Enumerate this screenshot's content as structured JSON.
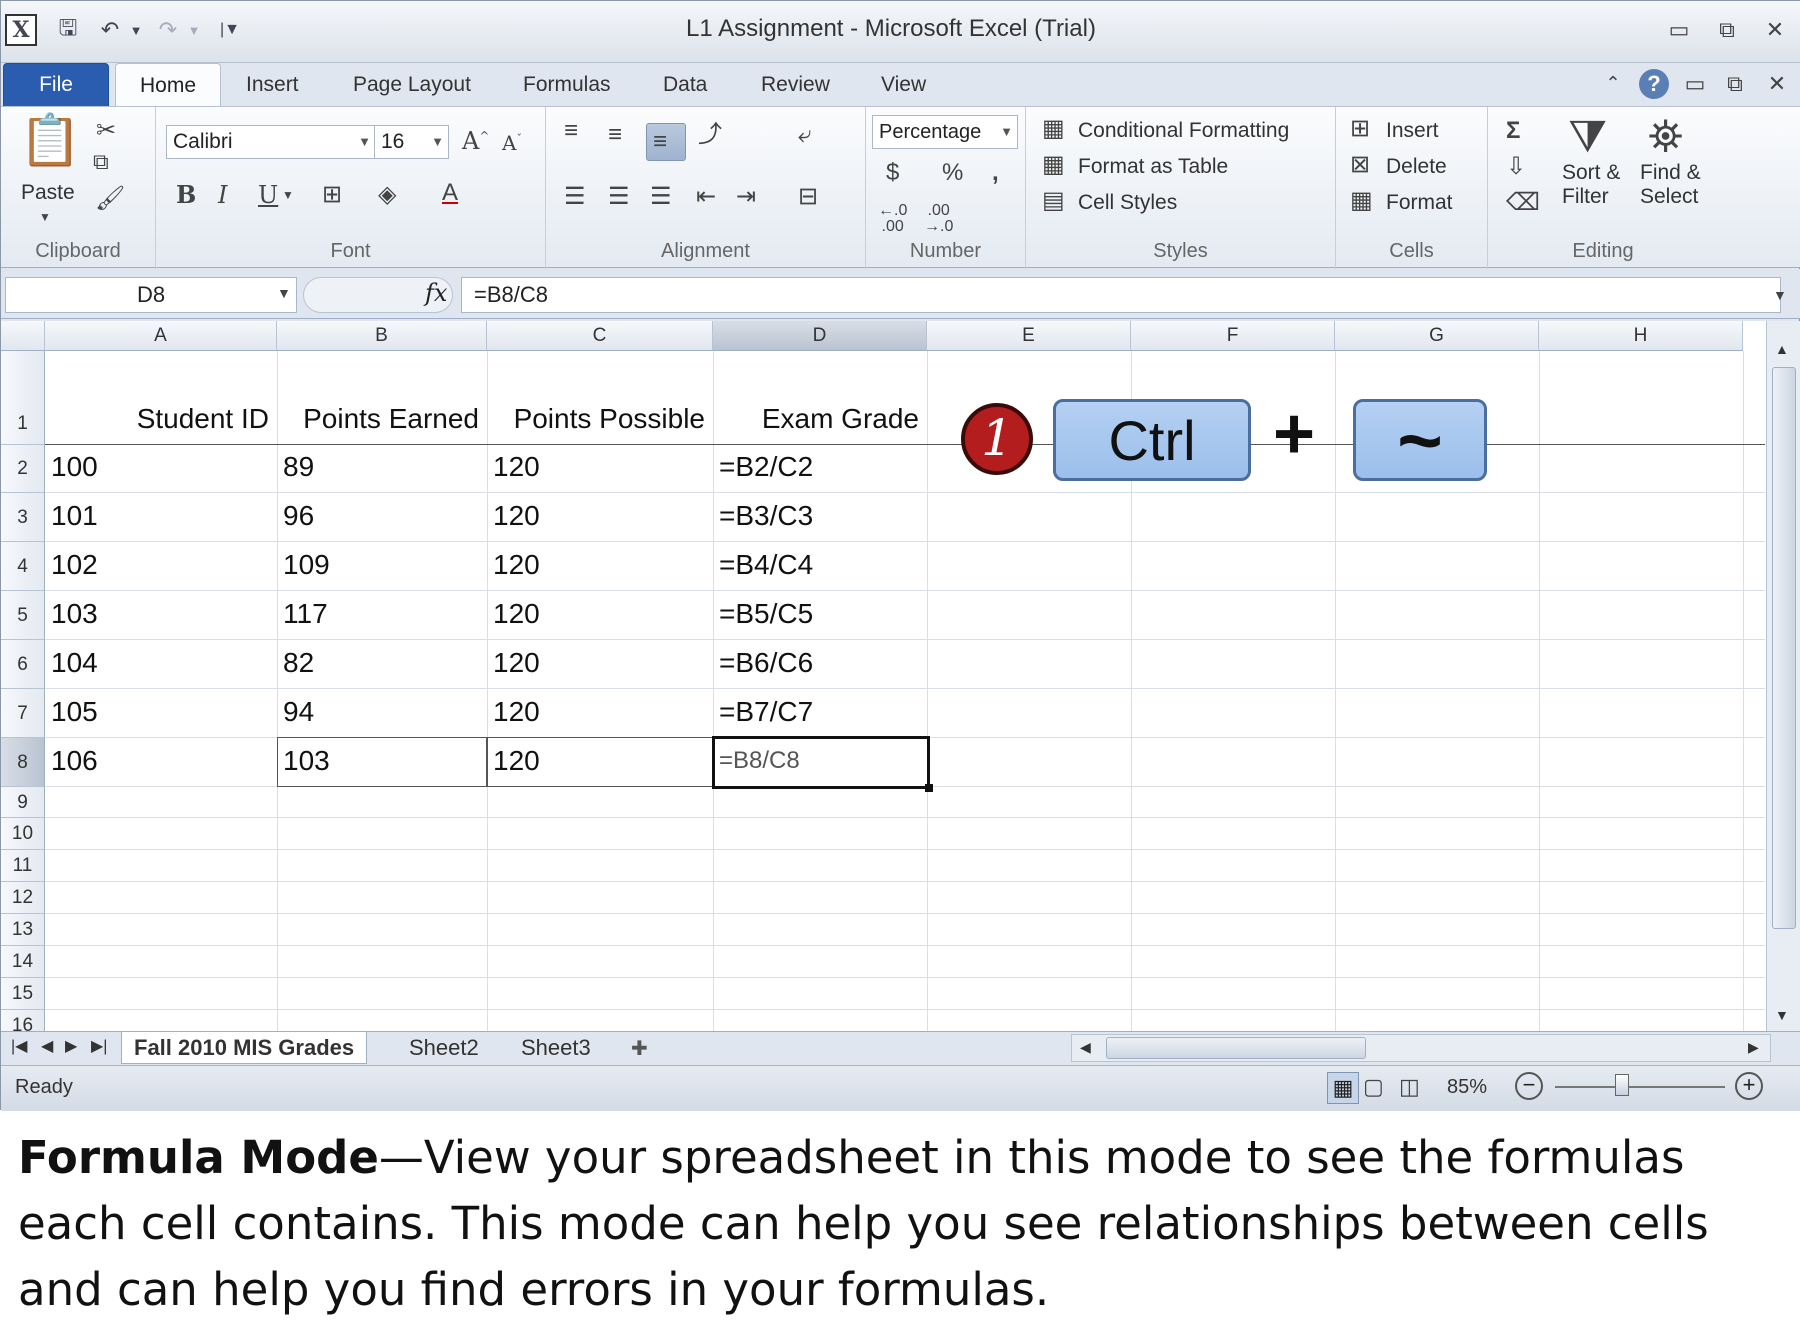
{
  "window": {
    "title": "L1 Assignment  -  Microsoft Excel (Trial)"
  },
  "tabs": [
    "File",
    "Home",
    "Insert",
    "Page Layout",
    "Formulas",
    "Data",
    "Review",
    "View"
  ],
  "ribbon": {
    "clipboard": {
      "label": "Clipboard",
      "paste": "Paste"
    },
    "font": {
      "label": "Font",
      "name": "Calibri",
      "size": "16",
      "bold": "B",
      "italic": "I",
      "underline": "U"
    },
    "alignment": {
      "label": "Alignment"
    },
    "number": {
      "label": "Number",
      "format": "Percentage",
      "currency": "$",
      "percent": "%",
      "comma": ","
    },
    "styles": {
      "label": "Styles",
      "conditional": "Conditional Formatting",
      "format_table": "Format as Table",
      "cell_styles": "Cell Styles"
    },
    "cells": {
      "label": "Cells",
      "insert": "Insert",
      "delete": "Delete",
      "format": "Format"
    },
    "editing": {
      "label": "Editing",
      "sum": "Σ",
      "sort1": "Sort &",
      "sort2": "Filter",
      "find1": "Find &",
      "find2": "Select"
    }
  },
  "formula_bar": {
    "name_box": "D8",
    "fx": "fx",
    "formula": "=B8/C8"
  },
  "columns": [
    "A",
    "B",
    "C",
    "D",
    "E",
    "F",
    "G",
    "H"
  ],
  "rows": [
    "1",
    "2",
    "3",
    "4",
    "5",
    "6",
    "7",
    "8",
    "9",
    "10",
    "11",
    "12",
    "13",
    "14",
    "15",
    "16"
  ],
  "headers": [
    "Student ID",
    "Points Earned",
    "Points Possible",
    "Exam Grade"
  ],
  "data": [
    [
      "100",
      "89",
      "120",
      "=B2/C2"
    ],
    [
      "101",
      "96",
      "120",
      "=B3/C3"
    ],
    [
      "102",
      "109",
      "120",
      "=B4/C4"
    ],
    [
      "103",
      "117",
      "120",
      "=B5/C5"
    ],
    [
      "104",
      "82",
      "120",
      "=B6/C6"
    ],
    [
      "105",
      "94",
      "120",
      "=B7/C7"
    ],
    [
      "106",
      "103",
      "120",
      "=B8/C8"
    ]
  ],
  "shortcut": {
    "step": "1",
    "key1": "Ctrl",
    "plus": "+",
    "key2": "~"
  },
  "sheets": [
    "Fall 2010 MIS Grades",
    "Sheet2",
    "Sheet3"
  ],
  "status": {
    "ready": "Ready",
    "zoom": "85%"
  },
  "caption": {
    "bold": "Formula Mode",
    "text": "—View your spreadsheet in this mode to see the formulas each cell contains.  This mode can help you see relationships between cells and can help you find errors in your formulas."
  }
}
